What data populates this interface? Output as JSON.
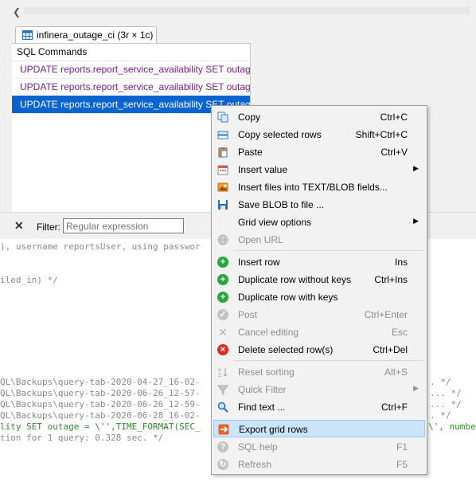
{
  "tab": {
    "label": "infinera_outage_ci (3r × 1c)"
  },
  "grid": {
    "header": "SQL Commands",
    "rows": [
      "UPDATE reports.report_service_availability SET outag...",
      "UPDATE reports.report_service_availability SET outag...",
      "UPDATE reports.report_service_availability SET outag..."
    ],
    "selected_row": 2
  },
  "filter": {
    "label": "Filter:",
    "placeholder": "Regular expression"
  },
  "log": {
    "lines": [
      "), username reportsUser, using passwor",
      "iled_in) */",
      "QL\\Backups\\query-tab-2020-04-27_16-02-",
      "QL\\Backups\\query-tab-2020-06-26_12-57-",
      "QL\\Backups\\query-tab-2020-06-26_12-59-",
      "QL\\Backups\\query-tab-2020-06-28_16-02-",
      "lity SET outage = \\'',TIME_FORMAT(SEC_",
      "tion for 1 query: 0.328 sec. */"
    ],
    "right_fragments": [
      ". */",
      "... */",
      "... */",
      ". */",
      "\\', numbe"
    ]
  },
  "menu": {
    "items": [
      {
        "label": "Copy",
        "shortcut": "Ctrl+C",
        "icon": "copy-icon",
        "disabled": false
      },
      {
        "label": "Copy selected rows",
        "shortcut": "Shift+Ctrl+C",
        "icon": "copy-rows-icon",
        "disabled": false
      },
      {
        "label": "Paste",
        "shortcut": "Ctrl+V",
        "icon": "paste-icon",
        "disabled": false
      },
      {
        "label": "Insert value",
        "shortcut": "",
        "icon": "calendar-icon",
        "disabled": false,
        "submenu": true
      },
      {
        "label": "Insert files into TEXT/BLOB fields...",
        "shortcut": "",
        "icon": "image-icon",
        "disabled": false
      },
      {
        "label": "Save BLOB to file ...",
        "shortcut": "",
        "icon": "save-icon",
        "disabled": false
      },
      {
        "label": "Grid view options",
        "shortcut": "",
        "icon": "",
        "disabled": false,
        "submenu": true
      },
      {
        "label": "Open URL",
        "shortcut": "",
        "icon": "globe-icon",
        "disabled": true
      },
      {
        "label": "Insert row",
        "shortcut": "Ins",
        "icon": "plus-icon",
        "disabled": false
      },
      {
        "label": "Duplicate row without keys",
        "shortcut": "Ctrl+Ins",
        "icon": "plus-icon",
        "disabled": false
      },
      {
        "label": "Duplicate row with keys",
        "shortcut": "",
        "icon": "plus-icon",
        "disabled": false
      },
      {
        "label": "Post",
        "shortcut": "Ctrl+Enter",
        "icon": "check-icon",
        "disabled": true
      },
      {
        "label": "Cancel editing",
        "shortcut": "Esc",
        "icon": "cross-icon",
        "disabled": true
      },
      {
        "label": "Delete selected row(s)",
        "shortcut": "Ctrl+Del",
        "icon": "delete-icon",
        "disabled": false
      },
      {
        "label": "Reset sorting",
        "shortcut": "Alt+S",
        "icon": "sort-icon",
        "disabled": true
      },
      {
        "label": "Quick Filter",
        "shortcut": "",
        "icon": "filter-icon",
        "disabled": true,
        "submenu": true
      },
      {
        "label": "Find text ...",
        "shortcut": "Ctrl+F",
        "icon": "magnifier-icon",
        "disabled": false
      },
      {
        "label": "Export grid rows",
        "shortcut": "",
        "icon": "export-icon",
        "disabled": false,
        "highlighted": true
      },
      {
        "label": "SQL help",
        "shortcut": "F1",
        "icon": "help-icon",
        "disabled": true
      },
      {
        "label": "Refresh",
        "shortcut": "F5",
        "icon": "refresh-icon",
        "disabled": true
      }
    ]
  }
}
